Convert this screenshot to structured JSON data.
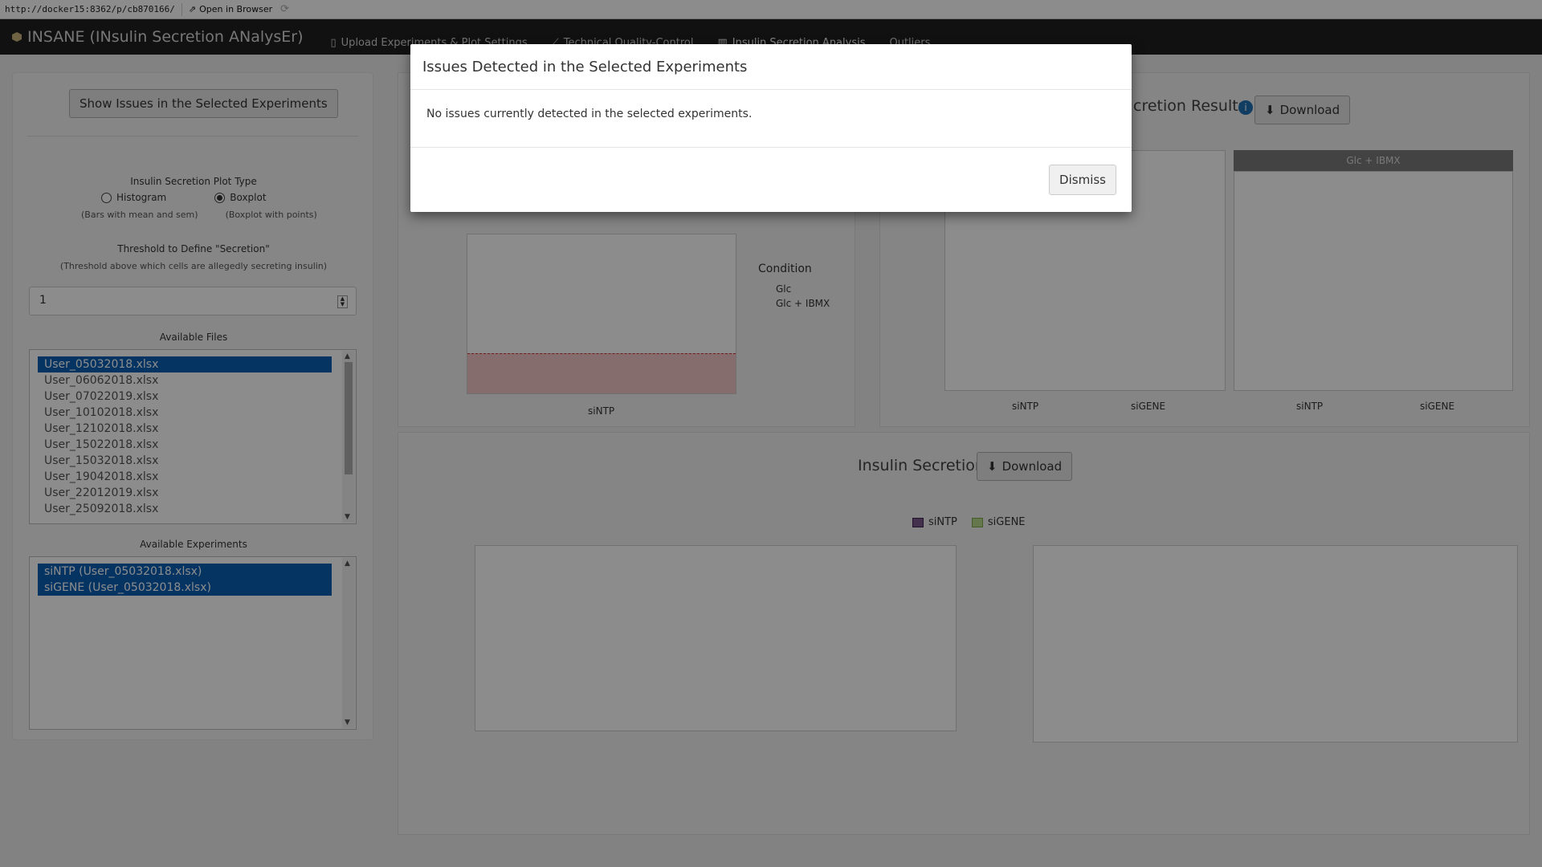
{
  "browser": {
    "url": "http://docker15:8362/p/cb870166/",
    "open_label": "Open in Browser"
  },
  "navbar": {
    "brand": "INSANE (INsulin Secretion ANalysEr)",
    "tabs": [
      {
        "label": "Upload Experiments & Plot Settings",
        "icon": "file-icon"
      },
      {
        "label": "Technical Quality-Control",
        "icon": "line-chart-icon"
      },
      {
        "label": "Insulin Secretion Analysis",
        "icon": "bar-chart-icon"
      },
      {
        "label": "Outliers",
        "icon": ""
      }
    ]
  },
  "sidebar": {
    "show_issues_label": "Show Issues in the Selected Experiments",
    "plot_type_label": "Insulin Secretion Plot Type",
    "options": [
      {
        "label": "Histogram",
        "note": "(Bars with mean and sem)",
        "selected": false
      },
      {
        "label": "Boxplot",
        "note": "(Boxplot with points)",
        "selected": true
      }
    ],
    "threshold_label": "Threshold to Define \"Secretion\"",
    "threshold_note": "(Threshold above which cells are allegedly secreting insulin)",
    "threshold_value": "1",
    "files_label": "Available Files",
    "files": [
      {
        "name": "User_05032018.xlsx",
        "selected": true
      },
      {
        "name": "User_06062018.xlsx",
        "selected": false
      },
      {
        "name": "User_07022019.xlsx",
        "selected": false
      },
      {
        "name": "User_10102018.xlsx",
        "selected": false
      },
      {
        "name": "User_12102018.xlsx",
        "selected": false
      },
      {
        "name": "User_15022018.xlsx",
        "selected": false
      },
      {
        "name": "User_15032018.xlsx",
        "selected": false
      },
      {
        "name": "User_19042018.xlsx",
        "selected": false
      },
      {
        "name": "User_22012019.xlsx",
        "selected": false
      },
      {
        "name": "User_25092018.xlsx",
        "selected": false
      }
    ],
    "experiments_label": "Available Experiments",
    "experiments": [
      {
        "name": "siNTP (User_05032018.xlsx)",
        "selected": true
      },
      {
        "name": "siGENE (User_05032018.xlsx)",
        "selected": true
      }
    ]
  },
  "panels": {
    "results_title": "cretion Results",
    "download_label": "Download",
    "insulin_secretion_title": "Insulin Secretion",
    "legend": [
      "siNTP",
      "siGENE"
    ],
    "facets": [
      "Glc + IBMX"
    ],
    "x_labels_top": [
      "siNTP",
      "siNTP",
      "siGENE",
      "siNTP",
      "siGENE"
    ],
    "condition_title": "Condition",
    "condition_items": [
      "Glc",
      "Glc + IBMX"
    ]
  },
  "modal": {
    "title": "Issues Detected in the Selected Experiments",
    "body": "No issues currently detected in the selected experiments.",
    "dismiss_label": "Dismiss"
  }
}
